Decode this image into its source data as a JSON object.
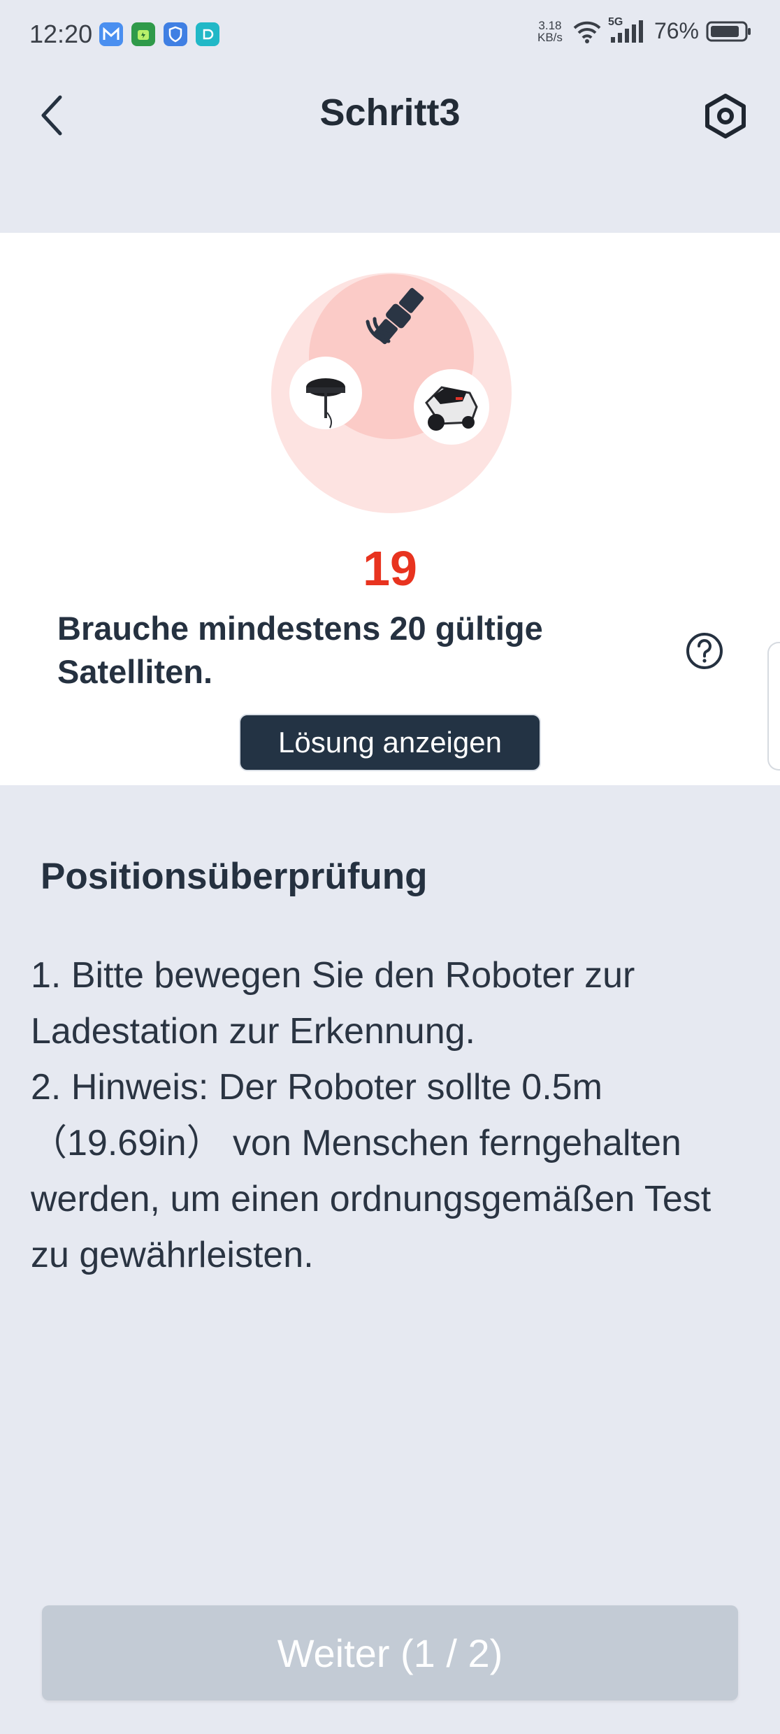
{
  "status_bar": {
    "time": "12:20",
    "net_speed_value": "3.18",
    "net_speed_unit": "KB/s",
    "network": "5G",
    "battery": "76%",
    "app_icons": [
      "mail-app-icon",
      "security-app-icon",
      "shield-app-icon",
      "app-icon"
    ]
  },
  "header": {
    "title": "Schritt3"
  },
  "satellite_card": {
    "count": "19",
    "message": "Brauche mindestens 20 gültige Satelliten.",
    "solution_button": "Lösung anzeigen",
    "count_color": "#e8331f"
  },
  "position_check": {
    "title": "Positionsüberprüfung",
    "step1": "1. Bitte bewegen Sie den Roboter zur Ladestation zur Erkennung.",
    "step2": "2. Hinweis: Der Roboter sollte 0.5m （19.69in） von Menschen ferngehalten werden, um einen ordnungsgemäßen Test zu gewährleisten."
  },
  "footer": {
    "next_button": "Weiter (1 / 2)"
  },
  "colors": {
    "background": "#e6e9f1",
    "card": "#ffffff",
    "primary_dark": "#233344",
    "accent_red": "#e8331f",
    "disabled_button": "#c3cbd5"
  }
}
